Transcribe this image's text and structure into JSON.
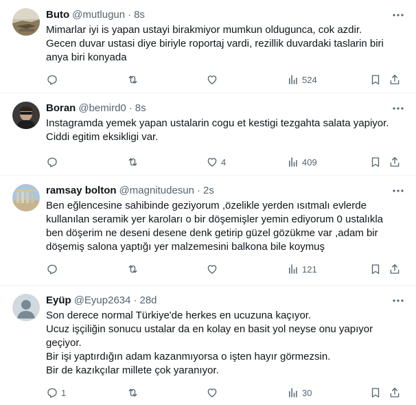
{
  "tweets": [
    {
      "name": "Buto",
      "handle": "@mutlugun",
      "dot": "·",
      "time": "8s",
      "lines": [
        "Mimarlar iyi is yapan ustayi birakmiyor mumkun oldugunca, cok azdir.",
        "Gecen duvar ustasi diye biriyle roportaj vardi, rezillik duvardaki taslarin biri",
        "anya biri konyada"
      ],
      "replies": "",
      "retweets": "",
      "likes": "",
      "views": "524"
    },
    {
      "name": "Boran",
      "handle": "@bemird0",
      "dot": "·",
      "time": "8s",
      "lines": [
        "Instagramda yemek yapan ustalarin cogu et kestigi tezgahta salata yapiyor.",
        "Ciddi egitim eksikligi var."
      ],
      "replies": "",
      "retweets": "",
      "likes": "4",
      "views": "409"
    },
    {
      "name": "ramsay bolton",
      "handle": "@magnitudesun",
      "dot": "·",
      "time": "2s",
      "lines": [
        "Ben eğlencesine sahibinde geziyorum ,özelikle yerden ısıtmalı evlerde",
        "kullanılan seramik yer karoları o bir döşemişler yemin ediyorum 0 ustalıkla",
        "ben döşerim ne deseni desene denk getirip güzel gözükme var ,adam bir",
        "döşemiş salona yaptığı yer malzemesini balkona bile koymuş"
      ],
      "replies": "",
      "retweets": "",
      "likes": "",
      "views": "121"
    },
    {
      "name": "Eyüp",
      "handle": "@Eyup2634",
      "dot": "·",
      "time": "28d",
      "lines": [
        "Son derece normal Türkiye'de herkes en ucuzuna kaçıyor.",
        "Ucuz işçiliğin sonucu ustalar da en kolay en basit yol neyse onu yapıyor",
        "geçiyor.",
        "Bir işi yaptırdığın adam kazanmıyorsa o işten hayır görmezsin.",
        "Bir de kazıkçılar millete çok yaranıyor."
      ],
      "replies": "1",
      "retweets": "",
      "likes": "",
      "views": "30"
    }
  ],
  "colors": {
    "text": "#0f1419",
    "muted": "#536471",
    "divider": "#eff3f4"
  },
  "icons": [
    "reply-icon",
    "retweet-icon",
    "like-icon",
    "views-icon",
    "bookmark-icon",
    "share-icon",
    "more-icon"
  ]
}
